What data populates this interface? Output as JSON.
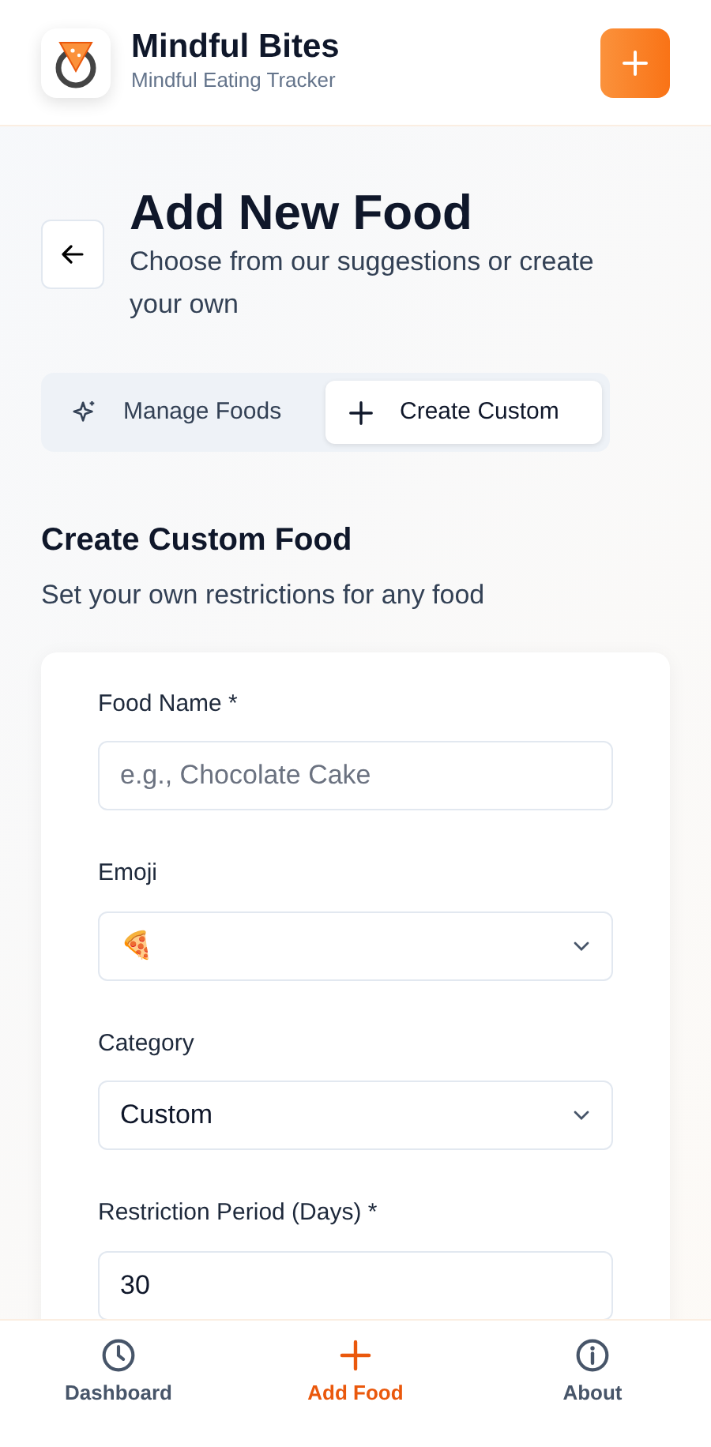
{
  "header": {
    "title": "Mindful Bites",
    "subtitle": "Mindful Eating Tracker"
  },
  "page": {
    "title": "Add New Food",
    "subtitle": "Choose from our suggestions or create your own"
  },
  "tabs": [
    {
      "label": "Manage Foods",
      "selected": false
    },
    {
      "label": "Create Custom",
      "selected": true
    }
  ],
  "section": {
    "title": "Create Custom Food",
    "subtitle": "Set your own restrictions for any food"
  },
  "form": [
    {
      "kind": "text",
      "label": "Food Name *",
      "placeholder": "e.g., Chocolate Cake"
    },
    {
      "kind": "select",
      "label": "Emoji",
      "value": "🍕"
    },
    {
      "kind": "select",
      "label": "Category",
      "value": "Custom"
    },
    {
      "kind": "text",
      "label": "Restriction Period (Days) *",
      "value": "30"
    }
  ],
  "bottom_nav": [
    {
      "label": "Dashboard",
      "selected": false
    },
    {
      "label": "Add Food",
      "selected": true
    },
    {
      "label": "About",
      "selected": false
    }
  ]
}
